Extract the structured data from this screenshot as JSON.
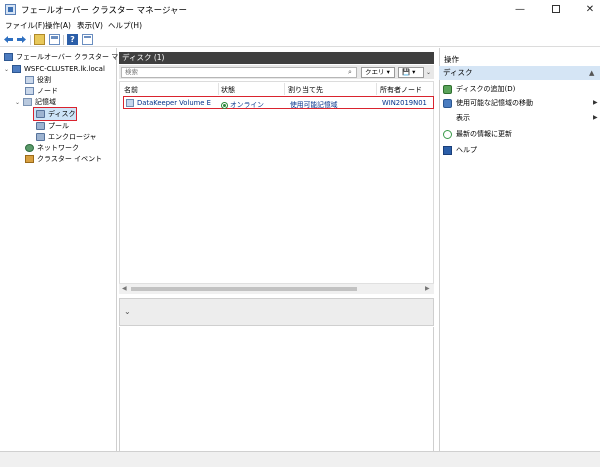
{
  "window": {
    "title": "フェールオーバー クラスター マネージャー",
    "minimize": "—",
    "close": "✕"
  },
  "menu": {
    "file": "ファイル(F)",
    "action": "操作(A)",
    "view": "表示(V)",
    "help": "ヘルプ(H)"
  },
  "toolbar": {
    "help_glyph": "?"
  },
  "tree": {
    "root": "フェールオーバー クラスター マネージャー",
    "cluster": "WSFC-CLUSTER.lk.local",
    "items": {
      "roles": "役割",
      "nodes": "ノード",
      "storage": "記憶域",
      "disks": "ディスク",
      "pools": "プール",
      "enclosures": "エンクロージャ",
      "networks": "ネットワーク",
      "cluster_events": "クラスター イベント"
    }
  },
  "center": {
    "header": "ディスク (1)",
    "search_placeholder": "検索",
    "query_label": "クエリ ▾",
    "save_label": "💾 ▾",
    "columns": {
      "name": "名前",
      "status": "状態",
      "assigned_to": "割り当て先",
      "owner_node": "所有者ノード"
    },
    "row": {
      "name": "DataKeeper Volume E",
      "status": "オンライン",
      "assigned_to": "使用可能記憶域",
      "owner_node": "WIN2019N01"
    }
  },
  "actions": {
    "title": "操作",
    "section": "ディスク",
    "items": {
      "add_disk": "ディスクの追加(D)",
      "move_available_storage": "使用可能な記憶域の移動",
      "view": "表示",
      "refresh": "最新の情報に更新",
      "help": "ヘルプ"
    }
  },
  "colors": {
    "highlight_border": "#d9232e",
    "center_header_bg": "#3f3f3f",
    "actions_section_bg": "#d5e5f5",
    "selected_tree_bg": "#cde4f7",
    "link_text": "#00308a"
  }
}
